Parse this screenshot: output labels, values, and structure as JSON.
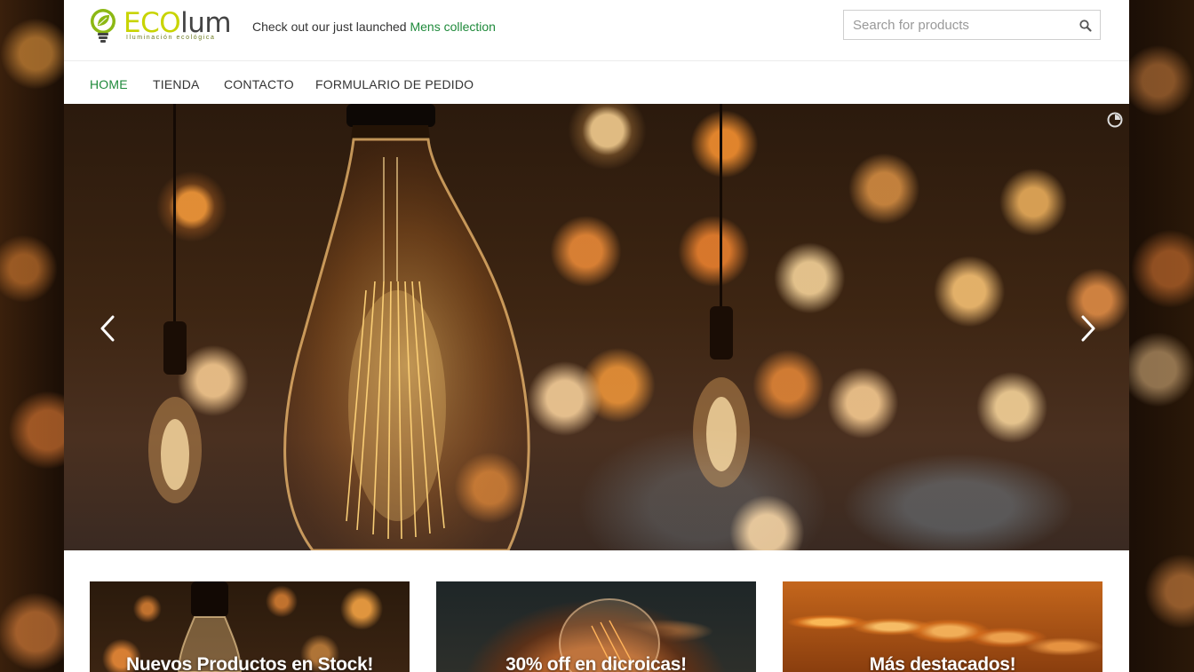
{
  "brand": {
    "name_part1": "ECO",
    "name_part2": "lum",
    "tagline": "Iluminación ecológica",
    "colors": {
      "eco": "#c8d400",
      "lum": "#444444",
      "accent": "#1f8a3b"
    }
  },
  "promo": {
    "text": "Check out our just launched ",
    "link": "Mens collection"
  },
  "search": {
    "placeholder": "Search for products",
    "icon": "search-icon"
  },
  "nav": {
    "items": [
      {
        "label": "HOME",
        "active": true
      },
      {
        "label": "TIENDA",
        "active": false
      },
      {
        "label": "CONTACTO",
        "active": false
      },
      {
        "label": "FORMULARIO DE PEDIDO",
        "active": false
      }
    ]
  },
  "slider": {
    "prev_icon": "chevron-left-icon",
    "next_icon": "chevron-right-icon",
    "pause_icon": "pause-circle-icon"
  },
  "tiles": [
    {
      "title": "Nuevos Productos en Stock!"
    },
    {
      "title": "30% off en dicroicas!"
    },
    {
      "title": "Más destacados!"
    }
  ]
}
